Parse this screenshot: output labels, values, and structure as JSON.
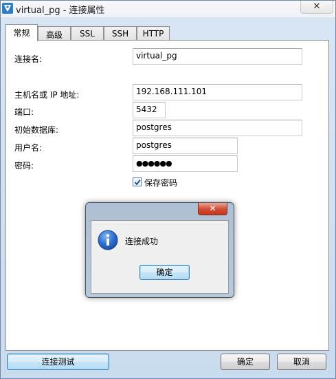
{
  "window": {
    "title": "virtual_pg - 连接属性",
    "close_glyph": "✕"
  },
  "tabs": [
    {
      "label": "常规",
      "active": true
    },
    {
      "label": "高级",
      "active": false
    },
    {
      "label": "SSL",
      "active": false
    },
    {
      "label": "SSH",
      "active": false
    },
    {
      "label": "HTTP",
      "active": false
    }
  ],
  "form": {
    "connection_name": {
      "label": "连接名:",
      "value": "virtual_pg"
    },
    "host": {
      "label": "主机名或 IP 地址:",
      "value": "192.168.111.101"
    },
    "port": {
      "label": "端口:",
      "value": "5432"
    },
    "initial_db": {
      "label": "初始数据库:",
      "value": "postgres"
    },
    "username": {
      "label": "用户名:",
      "value": "postgres"
    },
    "password": {
      "label": "密码:",
      "value": "●●●●●●"
    },
    "save_password": {
      "label": "保存密码",
      "checked": true
    }
  },
  "footer": {
    "test_button": "连接测试",
    "ok_button": "确定",
    "cancel_button": "取消"
  },
  "dialog": {
    "close_glyph": "✕",
    "message": "连接成功",
    "ok_button": "确定",
    "icon": "info-icon"
  },
  "colors": {
    "accent": "#3c7fb1",
    "dialog_close": "#c23a22"
  }
}
